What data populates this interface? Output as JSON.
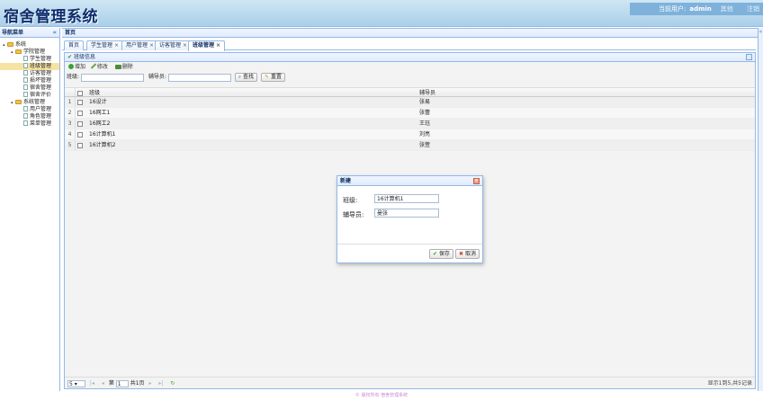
{
  "header": {
    "app_title": "宿舍管理系统",
    "user_prefix": "当前用户:",
    "user_name": "admin",
    "user_role": "其他",
    "logout": "注销"
  },
  "leftnav": {
    "title": "导航菜单",
    "collapse": "«",
    "tree": [
      {
        "label": "系统",
        "level": 0,
        "type": "folder",
        "arrow": "▴"
      },
      {
        "label": "学院管理",
        "level": 1,
        "type": "folder",
        "arrow": "▴"
      },
      {
        "label": "学生管理",
        "level": 2,
        "type": "file"
      },
      {
        "label": "班级管理",
        "level": 2,
        "type": "file",
        "selected": true
      },
      {
        "label": "访客管理",
        "level": 2,
        "type": "file"
      },
      {
        "label": "损坏管理",
        "level": 2,
        "type": "file"
      },
      {
        "label": "宿舍管理",
        "level": 2,
        "type": "file"
      },
      {
        "label": "宿舍评价",
        "level": 2,
        "type": "file"
      },
      {
        "label": "系统管理",
        "level": 1,
        "type": "folder",
        "arrow": "▴"
      },
      {
        "label": "用户管理",
        "level": 2,
        "type": "file"
      },
      {
        "label": "角色管理",
        "level": 2,
        "type": "file"
      },
      {
        "label": "菜单管理",
        "level": 2,
        "type": "file"
      }
    ]
  },
  "main": {
    "title": "首页",
    "right_collapse": "«",
    "tabs": [
      {
        "label": "首页",
        "closable": false
      },
      {
        "label": "学生管理",
        "closable": true
      },
      {
        "label": "用户管理",
        "closable": true
      },
      {
        "label": "访客管理",
        "closable": true
      },
      {
        "label": "班级管理",
        "closable": true,
        "active": true
      }
    ],
    "close_glyph": "×"
  },
  "panel": {
    "title": "班级信息",
    "toolbar": {
      "add": "增加",
      "edit": "修改",
      "delete": "删除"
    },
    "search": {
      "class_label": "班级:",
      "tutor_label": "辅导员:",
      "search_btn": "查找",
      "reset_btn": "重置"
    },
    "columns": {
      "name": "班级",
      "tutor": "辅导员"
    },
    "rows": [
      {
        "num": "1",
        "name": "16设计",
        "tutor": "张易"
      },
      {
        "num": "2",
        "name": "16网工1",
        "tutor": "张蕾"
      },
      {
        "num": "3",
        "name": "16网工2",
        "tutor": "王珏"
      },
      {
        "num": "4",
        "name": "16计算机1",
        "tutor": "刘亮"
      },
      {
        "num": "5",
        "name": "16计算机2",
        "tutor": "张萱"
      }
    ],
    "pager": {
      "page_size": "5",
      "page_prefix": "第",
      "page_num": "1",
      "page_suffix": "共1页",
      "info": "显示1到5,共5记录"
    }
  },
  "dialog": {
    "title": "新建",
    "close": "×",
    "class_label": "班级:",
    "class_value": "16计算机1",
    "tutor_label": "辅导员:",
    "tutor_value": "曼张",
    "save": "保存",
    "cancel": "取消"
  },
  "footer": {
    "text": "© 版权所有 宿舍管理系统"
  },
  "colors": {
    "accent": "#95b8e7",
    "header": "#a9cfe8",
    "selected": "#f6e3a4"
  }
}
